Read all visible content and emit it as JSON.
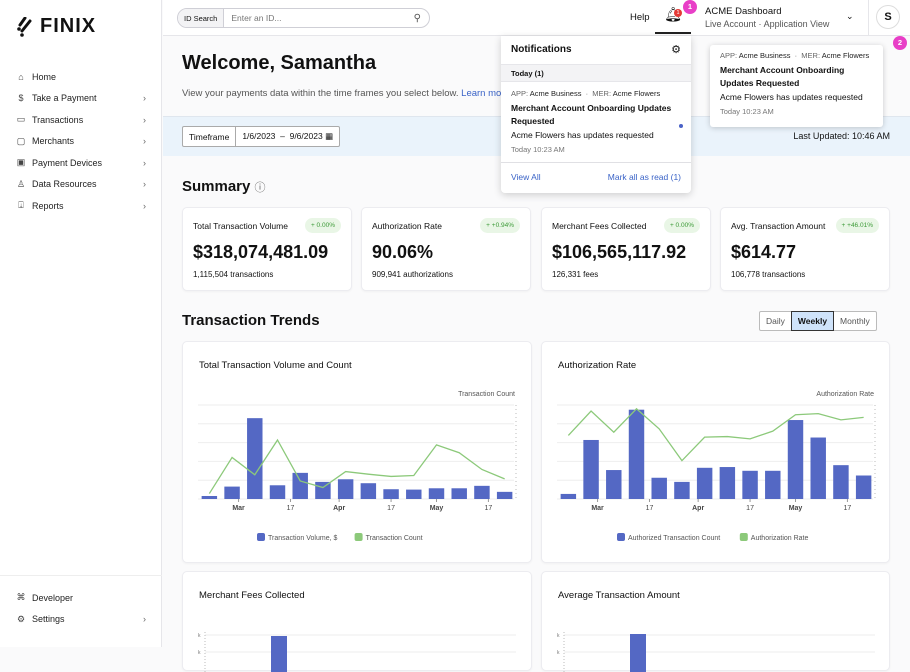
{
  "brand": {
    "name": "FINIX"
  },
  "sidebar": {
    "items": [
      {
        "label": "Home",
        "icon": "home-icon",
        "glyph": "⌂",
        "chevron": false
      },
      {
        "label": "Take a Payment",
        "icon": "payment-icon",
        "glyph": "$",
        "chevron": true
      },
      {
        "label": "Transactions",
        "icon": "card-icon",
        "glyph": "▭",
        "chevron": true
      },
      {
        "label": "Merchants",
        "icon": "store-icon",
        "glyph": "▢",
        "chevron": true
      },
      {
        "label": "Payment Devices",
        "icon": "device-icon",
        "glyph": "▣",
        "chevron": true
      },
      {
        "label": "Data Resources",
        "icon": "user-icon",
        "glyph": "♙",
        "chevron": true
      },
      {
        "label": "Reports",
        "icon": "download-icon",
        "glyph": "⍗",
        "chevron": true
      }
    ],
    "bottom": [
      {
        "label": "Developer",
        "icon": "developer-icon",
        "glyph": "⌘",
        "chevron": false
      },
      {
        "label": "Settings",
        "icon": "gear-icon",
        "glyph": "⚙",
        "chevron": true
      }
    ]
  },
  "topbar": {
    "id_search_label": "ID Search",
    "id_search_placeholder": "Enter an ID...",
    "help": "Help",
    "bell_count": "1",
    "account_title": "ACME Dashboard",
    "account_mode": "Live Account",
    "account_view": "Application View",
    "avatar": "S"
  },
  "header": {
    "title": "Welcome, Samantha",
    "intro": "View your payments data within the time frames you select below.",
    "learn_link": "Learn more"
  },
  "filters": {
    "timeframe_label": "Timeframe",
    "start": "1/6/2023",
    "end": "9/6/2023",
    "last_updated": "Last Updated: 10:46 AM"
  },
  "summary": {
    "title": "Summary",
    "cards": [
      {
        "title": "Total Transaction Volume",
        "change": "+ 0.00%",
        "value": "$318,074,481.09",
        "sub": "1,115,504 transactions"
      },
      {
        "title": "Authorization Rate",
        "change": "+ +0.94%",
        "value": "90.06%",
        "sub": "909,941 authorizations"
      },
      {
        "title": "Merchant Fees Collected",
        "change": "+ 0.00%",
        "value": "$106,565,117.92",
        "sub": "126,331 fees"
      },
      {
        "title": "Avg. Transaction Amount",
        "change": "+ +46.01%",
        "value": "$614.77",
        "sub": "106,778 transactions"
      }
    ]
  },
  "trends": {
    "title": "Transaction Trends",
    "periods": [
      "Daily",
      "Weekly",
      "Monthly"
    ],
    "selected": "Weekly"
  },
  "notifications": {
    "title": "Notifications",
    "group": "Today (1)",
    "app_label": "APP:",
    "app": "Acme Business",
    "mer_label": "MER:",
    "mer": "Acme Flowers",
    "item_title": "Merchant Account Onboarding Updates Requested",
    "item_body": "Acme Flowers has updates requested",
    "item_time": "Today 10:23 AM",
    "view_all": "View All",
    "mark_read": "Mark all as read (1)"
  },
  "toast": {
    "app_label": "APP:",
    "app": "Acme Business",
    "mer_label": "MER:",
    "mer": "Acme Flowers",
    "title": "Merchant Account Onboarding Updates Requested",
    "body": "Acme Flowers has updates requested",
    "time": "Today 10:23 AM"
  },
  "annotations": [
    "1",
    "2"
  ],
  "colors": {
    "bar": "#5468c4",
    "line": "#8cc97a",
    "accent": "#3a63c7",
    "pin": "#e83fc7"
  },
  "chart_data": [
    {
      "type": "bar+line",
      "title": "Total Transaction Volume and Count",
      "y2label": "Transaction Count",
      "x": [
        "2023-02-20",
        "2023-02-27",
        "2023-03-06",
        "2023-03-13",
        "2023-03-20",
        "2023-03-27",
        "2023-04-03",
        "2023-04-10",
        "2023-04-17",
        "2023-04-24",
        "2023-05-01",
        "2023-05-08",
        "2023-05-15",
        "2023-05-22"
      ],
      "xticks": [
        "Mar",
        "17",
        "Apr",
        "17",
        "May",
        "17"
      ],
      "series": [
        {
          "name": "Transaction Volume, $",
          "type": "bar",
          "values": [
            0.16,
            0.66,
            4.3,
            0.73,
            1.39,
            0.91,
            1.05,
            0.84,
            0.52,
            0.5,
            0.57,
            0.57,
            0.7,
            0.38
          ]
        },
        {
          "name": "Transaction Count",
          "type": "line",
          "values": [
            0.29,
            2.21,
            1.29,
            3.14,
            0.96,
            0.61,
            1.46,
            1.32,
            1.2,
            1.25,
            2.88,
            2.46,
            1.57,
            1.07
          ]
        }
      ],
      "grid": true,
      "legend": "bottom"
    },
    {
      "type": "bar+line",
      "title": "Authorization Rate",
      "y2label": "Authorization Rate",
      "x": [
        "2023-02-20",
        "2023-02-27",
        "2023-03-06",
        "2023-03-13",
        "2023-03-20",
        "2023-03-27",
        "2023-04-03",
        "2023-04-10",
        "2023-04-17",
        "2023-04-24",
        "2023-05-01",
        "2023-05-08",
        "2023-05-15",
        "2023-05-22"
      ],
      "xticks": [
        "Mar",
        "17",
        "Apr",
        "17",
        "May",
        "17"
      ],
      "series": [
        {
          "name": "Authorized Transaction Count",
          "type": "bar",
          "values": [
            0.27,
            3.14,
            1.54,
            4.75,
            1.13,
            0.91,
            1.66,
            1.7,
            1.5,
            1.5,
            4.2,
            3.27,
            1.8,
            1.25
          ]
        },
        {
          "name": "Authorization Rate",
          "type": "line",
          "values": [
            3.38,
            4.68,
            3.55,
            4.8,
            3.73,
            2.04,
            3.29,
            3.32,
            3.2,
            3.61,
            4.48,
            4.54,
            4.21,
            4.34
          ]
        }
      ],
      "grid": true,
      "legend": "bottom"
    },
    {
      "type": "bar",
      "title": "Merchant Fees Collected",
      "ytick": "k",
      "values": [
        null,
        null,
        null,
        1.8
      ]
    },
    {
      "type": "bar",
      "title": "Average Transaction Amount",
      "ytick": "k",
      "values": [
        null,
        null,
        null,
        1.9
      ]
    }
  ]
}
